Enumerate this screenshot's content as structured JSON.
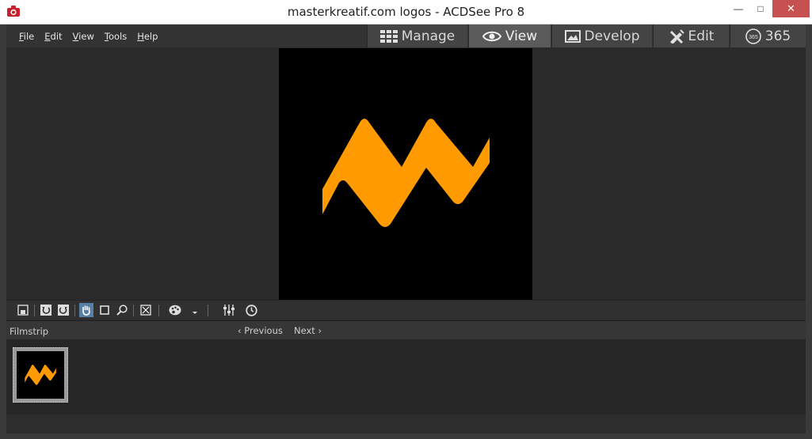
{
  "window": {
    "title": "masterkreatif.com logos - ACDSee Pro 8",
    "minimize": "—",
    "maximize": "□",
    "close": "✕"
  },
  "menu": {
    "items": [
      "File",
      "Edit",
      "View",
      "Tools",
      "Help"
    ]
  },
  "modes": {
    "manage": "Manage",
    "view": "View",
    "develop": "Develop",
    "edit": "Edit",
    "365": "365",
    "active": "view"
  },
  "filmstrip": {
    "title": "Filmstrip",
    "previous": "Previous",
    "next": "Next"
  },
  "colors": {
    "logo": "#ff9a00",
    "accent_active": "#5a7fa5",
    "close": "#c75050"
  },
  "icons": {
    "toolbar": [
      "save-image-icon",
      "rotate-left-icon",
      "rotate-right-icon",
      "hand-tool-icon",
      "select-tool-icon",
      "zoom-icon",
      "full-screen-icon",
      "color-palette-icon",
      "dropdown-arrow-icon",
      "adjust-sliders-icon",
      "clock-icon"
    ]
  }
}
